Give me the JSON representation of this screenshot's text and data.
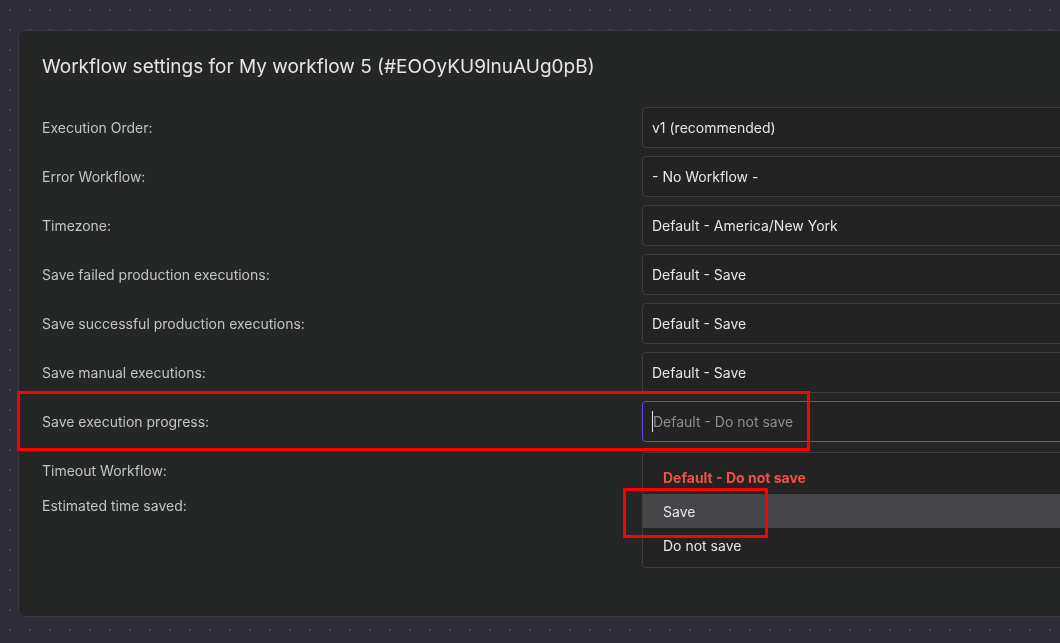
{
  "dialog": {
    "title": "Workflow settings for My workflow 5 (#EOOyKU9lnuAUg0pB)"
  },
  "rows": [
    {
      "label": "Execution Order:",
      "kind": "select",
      "value": "v1 (recommended)",
      "focused": false,
      "annotated": false
    },
    {
      "label": "Error Workflow:",
      "kind": "select",
      "value": "- No Workflow -",
      "focused": false,
      "annotated": false
    },
    {
      "label": "Timezone:",
      "kind": "select",
      "value": "Default - America/New York",
      "focused": false,
      "annotated": false
    },
    {
      "label": "Save failed production executions:",
      "kind": "select",
      "value": "Default - Save",
      "focused": false,
      "annotated": false
    },
    {
      "label": "Save successful production executions:",
      "kind": "select",
      "value": "Default - Save",
      "focused": false,
      "annotated": false
    },
    {
      "label": "Save manual executions:",
      "kind": "select",
      "value": "Default - Save",
      "focused": false,
      "annotated": false
    },
    {
      "label": "Save execution progress:",
      "kind": "select",
      "placeholder": "Default - Do not save",
      "focused": true,
      "annotated": true
    },
    {
      "label": "Timeout Workflow:",
      "kind": "plain"
    },
    {
      "label": "Estimated time saved:",
      "kind": "plain"
    }
  ],
  "dropdown": {
    "options": [
      {
        "label": "Default - Do not save",
        "selected": true,
        "hovered": false,
        "annotated": false
      },
      {
        "label": "Save",
        "selected": false,
        "hovered": true,
        "annotated": true
      },
      {
        "label": "Do not save",
        "selected": false,
        "hovered": false,
        "annotated": false
      }
    ]
  }
}
